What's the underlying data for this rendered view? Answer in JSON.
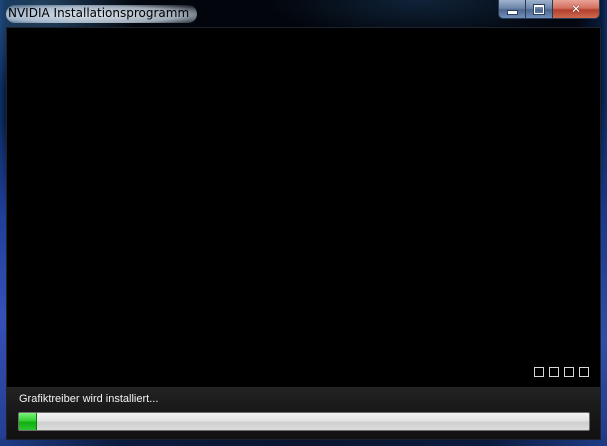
{
  "window": {
    "title": "NVIDIA Installationsprogramm",
    "controls": {
      "minimize_icon": "minimize-icon",
      "maximize_icon": "maximize-icon",
      "close_icon": "close-icon",
      "close_glyph": "✕"
    }
  },
  "slideshow": {
    "indicator_count": 4
  },
  "status": {
    "message": "Grafiktreiber wird installiert...",
    "progress_fraction": 0.03
  },
  "colors": {
    "progress_fill": "#2fc42f",
    "close_button": "#c8513b",
    "content_background": "#000000"
  }
}
